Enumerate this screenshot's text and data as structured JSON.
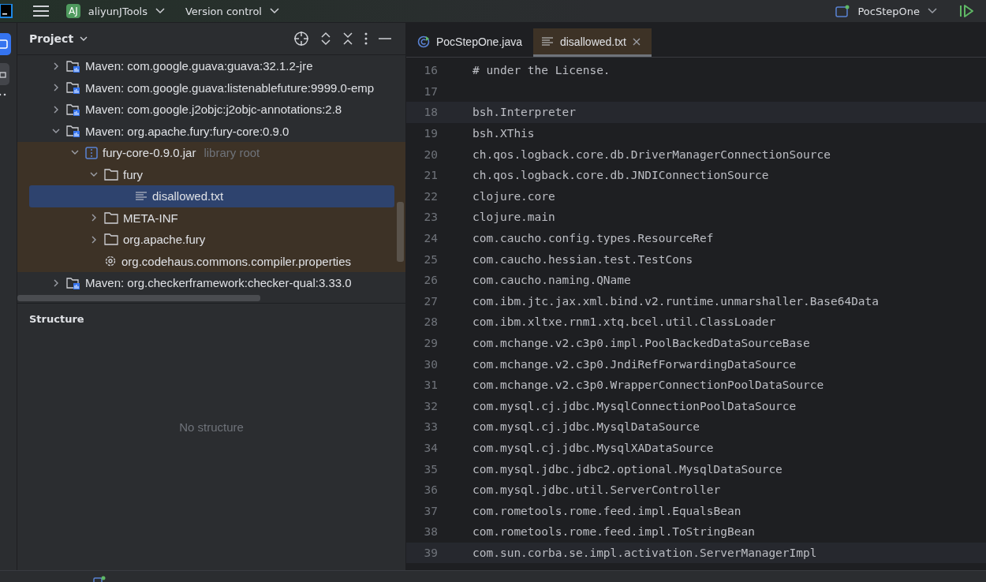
{
  "toolbar": {
    "project_badge": "AJ",
    "project": "aliyunJTools",
    "vcs": "Version control",
    "run_config": "PocStepOne"
  },
  "project_panel": {
    "title": "Project",
    "tree": [
      {
        "label": "Maven: com.google.guava:guava:32.1.2-jre",
        "kind": "library",
        "expanded": false,
        "selected": false
      },
      {
        "label": "Maven: com.google.guava:listenablefuture:9999.0-emp",
        "kind": "library",
        "expanded": false,
        "selected": false
      },
      {
        "label": "Maven: com.google.j2objc:j2objc-annotations:2.8",
        "kind": "library",
        "expanded": false,
        "selected": false
      },
      {
        "label": "Maven: org.apache.fury:fury-core:0.9.0",
        "kind": "library",
        "expanded": true,
        "selected": false,
        "children": [
          {
            "label": "fury-core-0.9.0.jar",
            "suffix": "library root",
            "kind": "jar",
            "expanded": true,
            "selected": false,
            "children": [
              {
                "label": "fury",
                "kind": "folder",
                "expanded": true,
                "selected": false,
                "children": [
                  {
                    "label": "disallowed.txt",
                    "kind": "text",
                    "selected": true
                  }
                ]
              },
              {
                "label": "META-INF",
                "kind": "folder",
                "expanded": false,
                "selected": false
              },
              {
                "label": "org.apache.fury",
                "kind": "folder",
                "expanded": false,
                "selected": false
              },
              {
                "label": "org.codehaus.commons.compiler.properties",
                "kind": "settings",
                "selected": false
              }
            ]
          }
        ]
      },
      {
        "label": "Maven: org.checkerframework:checker-qual:3.33.0",
        "kind": "library",
        "expanded": false,
        "selected": false
      }
    ]
  },
  "structure_panel": {
    "title": "Structure",
    "empty_text": "No structure"
  },
  "editor": {
    "tabs": [
      {
        "label": "PocStepOne.java",
        "kind": "java",
        "selected": false
      },
      {
        "label": "disallowed.txt",
        "kind": "text",
        "selected": true
      }
    ],
    "lines": [
      {
        "number": "16",
        "text": "# under the License.",
        "highlighted": false
      },
      {
        "number": "17",
        "highlighted": false
      },
      {
        "number": "18",
        "text": "bsh.Interpreter",
        "highlighted": true
      },
      {
        "number": "19",
        "text": "bsh.XThis",
        "highlighted": false
      },
      {
        "number": "20",
        "text": "ch.qos.logback.core.db.DriverManagerConnectionSource",
        "highlighted": false
      },
      {
        "number": "21",
        "text": "ch.qos.logback.core.db.JNDIConnectionSource",
        "highlighted": false
      },
      {
        "number": "22",
        "text": "clojure.core",
        "highlighted": false
      },
      {
        "number": "23",
        "text": "clojure.main",
        "highlighted": false
      },
      {
        "number": "24",
        "text": "com.caucho.config.types.ResourceRef",
        "highlighted": false
      },
      {
        "number": "25",
        "text": "com.caucho.hessian.test.TestCons",
        "highlighted": false
      },
      {
        "number": "26",
        "text": "com.caucho.naming.QName",
        "highlighted": false
      },
      {
        "number": "27",
        "text": "com.ibm.jtc.jax.xml.bind.v2.runtime.unmarshaller.Base64Data",
        "highlighted": false
      },
      {
        "number": "28",
        "text": "com.ibm.xltxe.rnm1.xtq.bcel.util.ClassLoader",
        "highlighted": false
      },
      {
        "number": "29",
        "text": "com.mchange.v2.c3p0.impl.PoolBackedDataSourceBase",
        "highlighted": false
      },
      {
        "number": "30",
        "text": "com.mchange.v2.c3p0.JndiRefForwardingDataSource",
        "highlighted": false
      },
      {
        "number": "31",
        "text": "com.mchange.v2.c3p0.WrapperConnectionPoolDataSource",
        "highlighted": false
      },
      {
        "number": "32",
        "text": "com.mysql.cj.jdbc.MysqlConnectionPoolDataSource",
        "highlighted": false
      },
      {
        "number": "33",
        "text": "com.mysql.cj.jdbc.MysqlDataSource",
        "highlighted": false
      },
      {
        "number": "34",
        "text": "com.mysql.cj.jdbc.MysqlXADataSource",
        "highlighted": false
      },
      {
        "number": "35",
        "text": "com.mysql.jdbc.jdbc2.optional.MysqlDataSource",
        "highlighted": false
      },
      {
        "number": "36",
        "text": "com.mysql.jdbc.util.ServerController",
        "highlighted": false
      },
      {
        "number": "37",
        "text": "com.rometools.rome.feed.impl.EqualsBean",
        "highlighted": false
      },
      {
        "number": "38",
        "text": "com.rometools.rome.feed.impl.ToStringBean",
        "highlighted": false
      },
      {
        "number": "39",
        "text": "com.sun.corba.se.impl.activation.ServerManagerImpl",
        "highlighted": true
      }
    ]
  }
}
